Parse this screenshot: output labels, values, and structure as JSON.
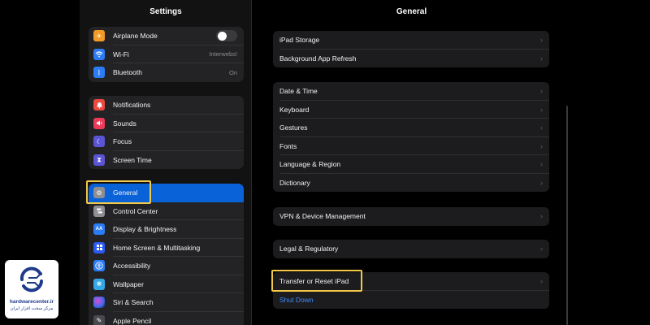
{
  "sidebar": {
    "title": "Settings",
    "group1": [
      {
        "label": "Airplane Mode",
        "icon": "airplane-icon",
        "color": "#f49a26",
        "control": "toggle"
      },
      {
        "label": "Wi-Fi",
        "icon": "wifi-icon",
        "color": "#2b7cf6",
        "value": "Interwebs!"
      },
      {
        "label": "Bluetooth",
        "icon": "bluetooth-icon",
        "color": "#2b7cf6",
        "value": "On"
      }
    ],
    "group2": [
      {
        "label": "Notifications",
        "icon": "bell-icon",
        "color": "#ec4a41"
      },
      {
        "label": "Sounds",
        "icon": "speaker-icon",
        "color": "#ec3b58"
      },
      {
        "label": "Focus",
        "icon": "moon-icon",
        "color": "#5b55d6"
      },
      {
        "label": "Screen Time",
        "icon": "hourglass-icon",
        "color": "#5b55d6"
      }
    ],
    "group3": [
      {
        "label": "General",
        "icon": "gear-icon",
        "color": "#8e8e93",
        "selected": true
      },
      {
        "label": "Control Center",
        "icon": "switches-icon",
        "color": "#8e8e93"
      },
      {
        "label": "Display & Brightness",
        "icon": "text-size-icon",
        "color": "#2b7cf6"
      },
      {
        "label": "Home Screen & Multitasking",
        "icon": "grid-icon",
        "color": "#2b5bf6"
      },
      {
        "label": "Accessibility",
        "icon": "accessibility-icon",
        "color": "#2b7cf6"
      },
      {
        "label": "Wallpaper",
        "icon": "flower-icon",
        "color": "#35a8e8"
      },
      {
        "label": "Siri & Search",
        "icon": "siri-icon",
        "color": "#2b2b2b"
      },
      {
        "label": "Apple Pencil",
        "icon": "pencil-icon",
        "color": "#4a4a4e"
      }
    ]
  },
  "detail": {
    "title": "General",
    "group1": [
      {
        "label": "iPad Storage"
      },
      {
        "label": "Background App Refresh"
      }
    ],
    "group2": [
      {
        "label": "Date & Time"
      },
      {
        "label": "Keyboard"
      },
      {
        "label": "Gestures"
      },
      {
        "label": "Fonts"
      },
      {
        "label": "Language & Region"
      },
      {
        "label": "Dictionary"
      }
    ],
    "group3": [
      {
        "label": "VPN & Device Management"
      }
    ],
    "group4": [
      {
        "label": "Legal & Regulatory"
      }
    ],
    "group5": [
      {
        "label": "Transfer or Reset iPad"
      },
      {
        "label": "Shut Down",
        "link": true
      }
    ],
    "chevron": "›"
  },
  "highlight_color": "#f3c94a",
  "watermark": {
    "site": "hardwarecenter.ir",
    "tagline": "مرکز سخت افزار ایران"
  }
}
